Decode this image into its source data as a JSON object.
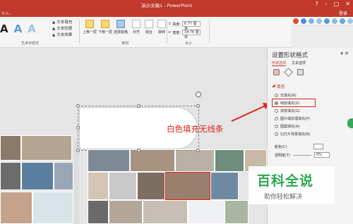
{
  "window": {
    "title": "演示文稿1 - PowerPoint",
    "controls": [
      "?",
      "–",
      "□",
      "✕"
    ]
  },
  "tabbar": {
    "hint": "什么...",
    "login": "登录"
  },
  "ribbon": {
    "wordart_group_label": "艺术字样式",
    "text_fill": "文本填充",
    "text_outline": "文本轮廓",
    "text_effects": "文本效果",
    "bring_forward": "上移一层",
    "send_backward": "下移一层",
    "selection_pane": "选择窗格",
    "align": "对齐",
    "group": "组合",
    "rotate": "旋转",
    "arrange_group_label": "排列",
    "height_label": "高度:",
    "height_value": "6.77 厘米",
    "width_label": "宽度:",
    "width_value": "34.76 厘米",
    "size_group_label": "大小"
  },
  "annotation": {
    "text": "白色填充无线条",
    "color": "#e0201a"
  },
  "panel": {
    "title": "设置形状格式",
    "tab_shape": "形状选项",
    "tab_text": "文本选项",
    "section_fill": "填充",
    "options": [
      {
        "label": "无填充(N)",
        "selected": false
      },
      {
        "label": "纯色填充(S)",
        "selected": true
      },
      {
        "label": "渐变填充(G)",
        "selected": false
      },
      {
        "label": "图片或纹理填充(P)",
        "selected": false
      },
      {
        "label": "图案填充(A)",
        "selected": false
      },
      {
        "label": "幻灯片背景填充(B)",
        "selected": false
      }
    ],
    "color_label": "颜色(C)",
    "transparency_label": "透明度(T)",
    "transparency_value": "0%"
  },
  "watermark": {
    "big": "百科全说",
    "small": "助你轻松解决"
  },
  "colors": {
    "title_bar": "#c0392b",
    "annotation_red": "#e0201a",
    "watermark_green": "#2da84f"
  }
}
